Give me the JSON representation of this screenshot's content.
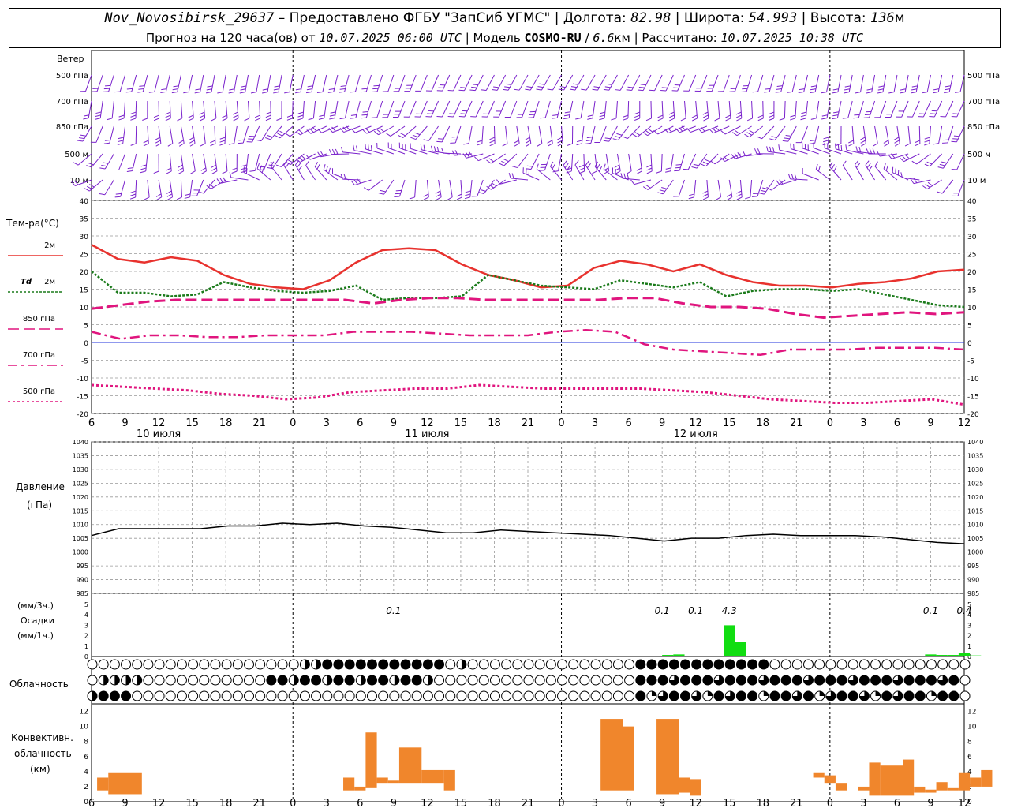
{
  "header": {
    "station": "Nov_Novosibirsk_29637",
    "provider": " – Предоставлено ФГБУ \"ЗапСиб УГМС\" | Долгота: ",
    "lon": "82.98",
    "lat_label": " | Широта: ",
    "lat": "54.993",
    "alt_label": " | Высота: ",
    "alt": "136",
    "alt_unit": "м",
    "forecast_label": "Прогноз на 120 часа(ов) от ",
    "forecast_time": "10.07.2025 06:00 UTC",
    "model_label": "  | Модель ",
    "model": "COSMO-RU",
    "res_sep": " / ",
    "res": "6.6",
    "res_unit": "км",
    "calc_label": " | Рассчитано: ",
    "calc_time": "10.07.2025 10:38 UTC"
  },
  "colors": {
    "wind": "#7a22cc",
    "t2m": "#e8322e",
    "td2m": "#1a7a1a",
    "t850": "#e0157e",
    "t700": "#e0157e",
    "t500": "#e0157e",
    "zero_line": "#2233dd",
    "precip": "#11dd11",
    "conv": "#f0862c"
  },
  "chart_data": [
    {
      "type": "wind-barbs",
      "title": "Ветер",
      "levels": [
        "500 гПа",
        "700 гПа",
        "850 гПа",
        "500 м",
        "10  м"
      ],
      "barbs_shown": "hourly wind barbs at each level"
    },
    {
      "type": "line",
      "title": "Тем-ра(°C)",
      "ylim": [
        -20,
        40
      ],
      "yticks": [
        40,
        35,
        30,
        25,
        20,
        15,
        10,
        5,
        0,
        -5,
        -10,
        -15,
        -20
      ],
      "x_hours": [
        0,
        3,
        6,
        9,
        12,
        15,
        18,
        21,
        24,
        27,
        30,
        33,
        36,
        39,
        42,
        45,
        48,
        51,
        54,
        57,
        60,
        63,
        66,
        69,
        72,
        75,
        78
      ],
      "series": [
        {
          "name": "2м",
          "values": [
            27.5,
            23.5,
            22.5,
            24,
            23,
            19,
            16.5,
            15.5,
            15,
            17.5,
            22.5,
            26,
            26.5,
            26,
            22,
            19,
            17.5,
            15.5,
            16,
            21,
            23,
            22,
            20,
            22,
            19,
            17,
            16,
            16,
            15.5,
            16.5,
            17,
            18,
            20,
            20.5
          ]
        },
        {
          "name": "Td 2м",
          "values": [
            20,
            14,
            14,
            13,
            13.5,
            17,
            15.5,
            14.5,
            14,
            14.5,
            16,
            12,
            12.5,
            12.5,
            13,
            19,
            17.5,
            16,
            15.5,
            15,
            17.5,
            16.5,
            15.5,
            17,
            13,
            14.5,
            15,
            15,
            14.5,
            15,
            13.5,
            12,
            10.5,
            10
          ]
        },
        {
          "name": "850 гПа",
          "values": [
            9.5,
            10.5,
            11.5,
            12,
            12,
            12,
            12,
            12,
            12,
            12,
            11,
            12,
            12.5,
            12.5,
            12,
            12,
            12,
            12,
            12,
            12.5,
            12.5,
            11,
            10,
            10,
            9.5,
            8,
            7,
            7.5,
            8,
            8.5,
            8,
            8.5
          ]
        },
        {
          "name": "700 гПа",
          "values": [
            3,
            1,
            2,
            2,
            1.5,
            1.5,
            2,
            2,
            2,
            3,
            3,
            3,
            2.5,
            2,
            2,
            2,
            3,
            3.5,
            3,
            -0.5,
            -2,
            -2.5,
            -3,
            -3.5,
            -2,
            -2,
            -2,
            -1.5,
            -1.5,
            -1.5,
            -2
          ]
        },
        {
          "name": "500 гПа",
          "values": [
            -12,
            -12.5,
            -13,
            -13.5,
            -14.5,
            -15,
            -16,
            -15.5,
            -14,
            -13.5,
            -13,
            -13,
            -12,
            -12.5,
            -13,
            -13,
            -13,
            -13,
            -13.5,
            -14,
            -15,
            -16,
            -16.5,
            -17,
            -17,
            -16.5,
            -16,
            -17.5
          ]
        }
      ]
    },
    {
      "type": "line",
      "title": "Давление",
      "ylabel": "(гПа)",
      "ylim": [
        985,
        1040
      ],
      "yticks": [
        1040,
        1035,
        1030,
        1025,
        1020,
        1015,
        1010,
        1005,
        1000,
        995,
        990,
        985
      ],
      "series": [
        {
          "name": "",
          "values": [
            1006,
            1008.5,
            1008.5,
            1008.5,
            1008.5,
            1009.5,
            1009.5,
            1010.5,
            1010,
            1010.5,
            1009.5,
            1009,
            1008,
            1007,
            1007,
            1008,
            1007.5,
            1007,
            1006.5,
            1006,
            1005,
            1004,
            1005,
            1005,
            1006,
            1006.5,
            1006,
            1006,
            1006,
            1005.5,
            1004.5,
            1003.5,
            1003
          ]
        }
      ]
    },
    {
      "type": "bar",
      "title": "Осадки",
      "ylabel_3h": "(мм/3ч.)",
      "ylabel_1h": "(мм/1ч.)",
      "ylim": [
        0,
        5
      ],
      "yticks": [
        5,
        4,
        3,
        2,
        1,
        0
      ],
      "annotations": [
        {
          "x": 27,
          "text": "0.1"
        },
        {
          "x": 51,
          "text": "0.1"
        },
        {
          "x": 54,
          "text": "0.1"
        },
        {
          "x": 57,
          "text": "4.3"
        },
        {
          "x": 75,
          "text": "0.1"
        },
        {
          "x": 78,
          "text": "0.4"
        }
      ],
      "bars": [
        {
          "x": 27,
          "value": 0.05
        },
        {
          "x": 44,
          "value": 0.05
        },
        {
          "x": 51.5,
          "value": 0.15
        },
        {
          "x": 52.5,
          "value": 0.2
        },
        {
          "x": 57,
          "value": 3
        },
        {
          "x": 58,
          "value": 1.4
        },
        {
          "x": 75,
          "value": 0.2
        },
        {
          "x": 76,
          "value": 0.15
        },
        {
          "x": 77,
          "value": 0.15
        },
        {
          "x": 78,
          "value": 0.35
        },
        {
          "x": 79,
          "value": 0.1
        }
      ]
    },
    {
      "type": "table",
      "title": "Облачность",
      "rows": 3,
      "note": "cloud-cover symbols: empty circle = clear, filled = overcast, quarters shown by filled sectors"
    },
    {
      "type": "bar",
      "title": "Конвективн. облачность",
      "ylabel": "(км)",
      "ylim": [
        0,
        13
      ],
      "yticks": [
        12,
        10,
        8,
        6,
        4,
        2,
        0
      ],
      "bars": [
        {
          "x0": 0.5,
          "x1": 1.5,
          "bottom": 1.5,
          "top": 3.2
        },
        {
          "x0": 1.5,
          "x1": 4.5,
          "bottom": 1,
          "top": 3.8
        },
        {
          "x0": 22.5,
          "x1": 23.5,
          "bottom": 1.5,
          "top": 3.2
        },
        {
          "x0": 23.5,
          "x1": 24.5,
          "bottom": 1.5,
          "top": 2
        },
        {
          "x0": 24.5,
          "x1": 25.5,
          "bottom": 1.8,
          "top": 9.2
        },
        {
          "x0": 25.5,
          "x1": 26.5,
          "bottom": 2.5,
          "top": 3.2
        },
        {
          "x0": 26.5,
          "x1": 27.5,
          "bottom": 2.5,
          "top": 2.8
        },
        {
          "x0": 27.5,
          "x1": 29.5,
          "bottom": 2.5,
          "top": 7.2
        },
        {
          "x0": 29.5,
          "x1": 31.5,
          "bottom": 2.5,
          "top": 4.2
        },
        {
          "x0": 31.5,
          "x1": 32.5,
          "bottom": 1.5,
          "top": 4.2
        },
        {
          "x0": 45.5,
          "x1": 47.5,
          "bottom": 1.5,
          "top": 11
        },
        {
          "x0": 47.5,
          "x1": 48.5,
          "bottom": 1.5,
          "top": 10
        },
        {
          "x0": 50.5,
          "x1": 52.5,
          "bottom": 1,
          "top": 11
        },
        {
          "x0": 52.5,
          "x1": 53.5,
          "bottom": 1.2,
          "top": 3.2
        },
        {
          "x0": 53.5,
          "x1": 54.5,
          "bottom": 0.8,
          "top": 3
        },
        {
          "x0": 64.5,
          "x1": 65.5,
          "bottom": 3.2,
          "top": 3.8
        },
        {
          "x0": 65.5,
          "x1": 66.5,
          "bottom": 2.5,
          "top": 3.5
        },
        {
          "x0": 66.5,
          "x1": 67.5,
          "bottom": 1.5,
          "top": 2.5
        },
        {
          "x0": 68.5,
          "x1": 69.5,
          "bottom": 1.5,
          "top": 2
        },
        {
          "x0": 69.5,
          "x1": 70.5,
          "bottom": 0.8,
          "top": 5.2
        },
        {
          "x0": 70.5,
          "x1": 72.5,
          "bottom": 0.8,
          "top": 4.8
        },
        {
          "x0": 72.5,
          "x1": 73.5,
          "bottom": 0.8,
          "top": 5.6
        },
        {
          "x0": 73.5,
          "x1": 74.5,
          "bottom": 1.2,
          "top": 2
        },
        {
          "x0": 74.5,
          "x1": 75.5,
          "bottom": 1.2,
          "top": 1.6
        },
        {
          "x0": 75.5,
          "x1": 76.5,
          "bottom": 1.5,
          "top": 2.6
        },
        {
          "x0": 76.5,
          "x1": 77.5,
          "bottom": 1.5,
          "top": 1.8
        },
        {
          "x0": 77.5,
          "x1": 78.5,
          "bottom": 1.5,
          "top": 3.8
        },
        {
          "x0": 78.5,
          "x1": 79.5,
          "bottom": 2,
          "top": 3.2
        },
        {
          "x0": 79.5,
          "x1": 80.5,
          "bottom": 2,
          "top": 4.2
        }
      ]
    }
  ],
  "x_axis": {
    "tick_labels": [
      "6",
      "9",
      "12",
      "15",
      "18",
      "21",
      "0",
      "3",
      "6",
      "9",
      "12",
      "15",
      "18",
      "21",
      "0",
      "3",
      "6",
      "9",
      "12",
      "15",
      "18",
      "21",
      "0",
      "3",
      "6",
      "9",
      "12"
    ],
    "days": [
      "10 июля",
      "11 июля",
      "12 июля"
    ]
  },
  "legend": {
    "t2m": "2м",
    "td_label": "Td",
    "td2m": "2м",
    "t850": "850 гПа",
    "t700": "700 гПа",
    "t500": "500 гПа"
  }
}
